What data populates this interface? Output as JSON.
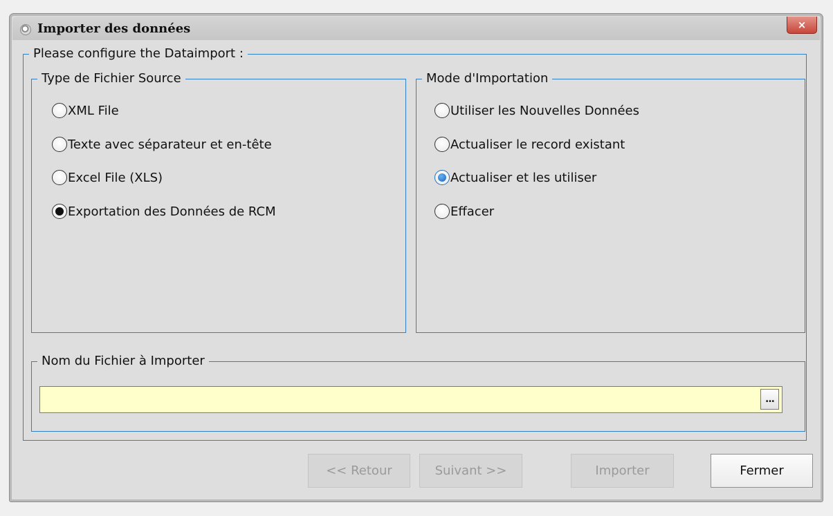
{
  "window": {
    "title": "Importer des données",
    "close_glyph": "×"
  },
  "config_group": {
    "legend": "Please configure the Dataimport :"
  },
  "source_type": {
    "legend": "Type de Fichier Source",
    "options": [
      {
        "label": "XML File",
        "selected": false
      },
      {
        "label": "Texte avec séparateur et en-tête",
        "selected": false
      },
      {
        "label": "Excel File (XLS)",
        "selected": false
      },
      {
        "label": "Exportation des Données de RCM",
        "selected": true
      }
    ]
  },
  "import_mode": {
    "legend": "Mode d'Importation",
    "options": [
      {
        "label": "Utiliser les Nouvelles Données",
        "selected": false
      },
      {
        "label": "Actualiser le record existant",
        "selected": false
      },
      {
        "label": "Actualiser et les utiliser",
        "selected": true
      },
      {
        "label": "Effacer",
        "selected": false
      }
    ]
  },
  "file_group": {
    "legend": "Nom du Fichier à Importer",
    "value": "",
    "browse_label": "..."
  },
  "buttons": {
    "back": {
      "label": "<< Retour",
      "enabled": false
    },
    "next": {
      "label": "Suivant >>",
      "enabled": false
    },
    "import": {
      "label": "Importer",
      "enabled": false
    },
    "close": {
      "label": "Fermer",
      "enabled": true
    }
  },
  "colors": {
    "group_border": "#2f80c8",
    "file_field_bg": "#ffffcc",
    "radio_selected_blue": "#1565c0",
    "close_button": "#c7463a"
  }
}
